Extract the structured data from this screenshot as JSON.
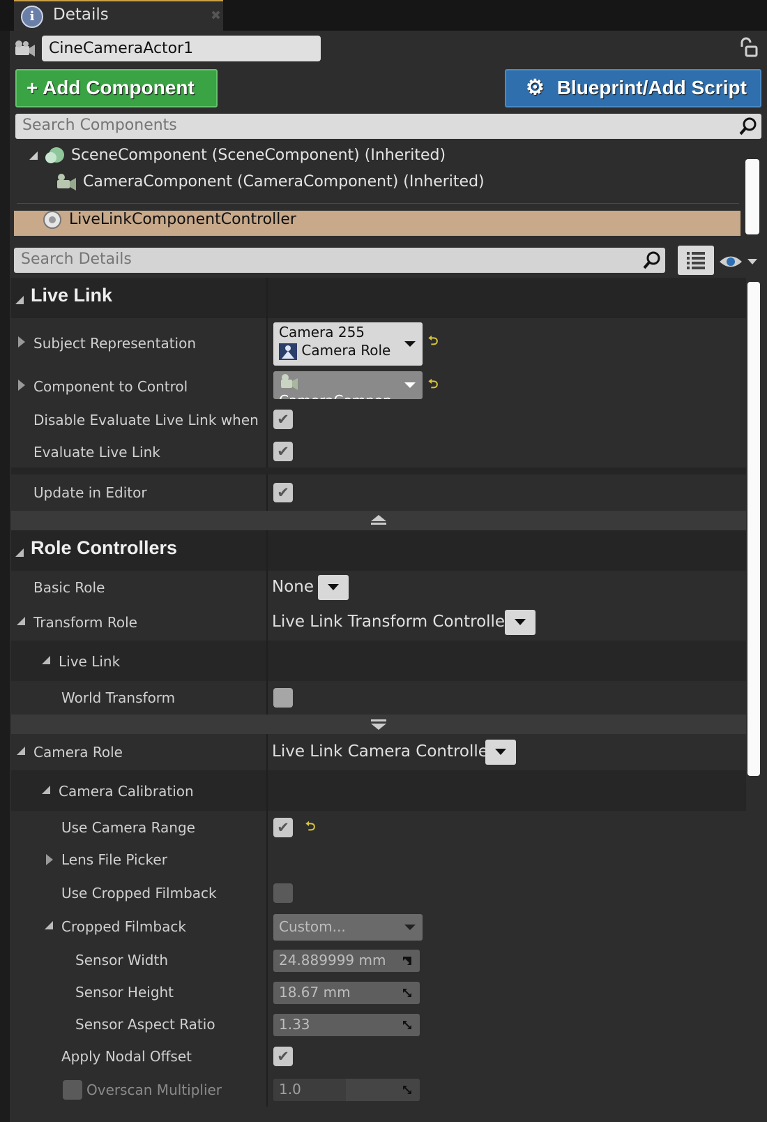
{
  "tab": {
    "title": "Details"
  },
  "actor": {
    "name": "CineCameraActor1"
  },
  "toolbar": {
    "add_component": "Add Component",
    "blueprint_script": "Blueprint/Add Script"
  },
  "search_components": {
    "placeholder": "Search Components"
  },
  "components": [
    {
      "label": "SceneComponent (SceneComponent) (Inherited)"
    },
    {
      "label": "CameraComponent (CameraComponent) (Inherited)"
    },
    {
      "label": "LiveLinkComponentController"
    }
  ],
  "search_details": {
    "placeholder": "Search Details"
  },
  "live_link": {
    "title": "Live Link",
    "subject_representation": {
      "label": "Subject Representation",
      "subject": "Camera 255",
      "role": "Camera Role"
    },
    "component_to_control": {
      "label": "Component to Control",
      "value": "CameraCompon"
    },
    "disable_evaluate": {
      "label": "Disable Evaluate Live Link when Spa",
      "checked": true
    },
    "evaluate": {
      "label": "Evaluate Live Link",
      "checked": true
    },
    "update_in_editor": {
      "label": "Update in Editor",
      "checked": true
    }
  },
  "role_controllers": {
    "title": "Role Controllers",
    "basic_role": {
      "label": "Basic Role",
      "value": "None"
    },
    "transform_role": {
      "label": "Transform Role",
      "value": "Live Link Transform Controller"
    },
    "transform_live_link": {
      "label": "Live Link"
    },
    "world_transform": {
      "label": "World Transform",
      "checked": false
    },
    "camera_role": {
      "label": "Camera Role",
      "value": "Live Link Camera Controller"
    },
    "camera_calibration": {
      "label": "Camera Calibration"
    },
    "use_camera_range": {
      "label": "Use Camera Range",
      "checked": true
    },
    "lens_file_picker": {
      "label": "Lens File Picker"
    },
    "use_cropped_filmback": {
      "label": "Use Cropped Filmback",
      "checked": false
    },
    "cropped_filmback": {
      "label": "Cropped Filmback",
      "value": "Custom..."
    },
    "sensor_width": {
      "label": "Sensor Width",
      "value": "24.889999 mm"
    },
    "sensor_height": {
      "label": "Sensor Height",
      "value": "18.67 mm"
    },
    "sensor_aspect_ratio": {
      "label": "Sensor Aspect Ratio",
      "value": "1.33"
    },
    "apply_nodal_offset": {
      "label": "Apply Nodal Offset",
      "checked": true
    },
    "overscan_multiplier": {
      "label": "Overscan Multiplier",
      "value": "1.0"
    }
  },
  "icons": {
    "check": "✔",
    "reset": "⮌",
    "add": "+",
    "gear": "⚙"
  },
  "colors": {
    "add_button": "#3aa343",
    "blueprint_button": "#2f6fad",
    "selected_row": "#c8a98a",
    "reset_arrow": "#d7c43a"
  }
}
